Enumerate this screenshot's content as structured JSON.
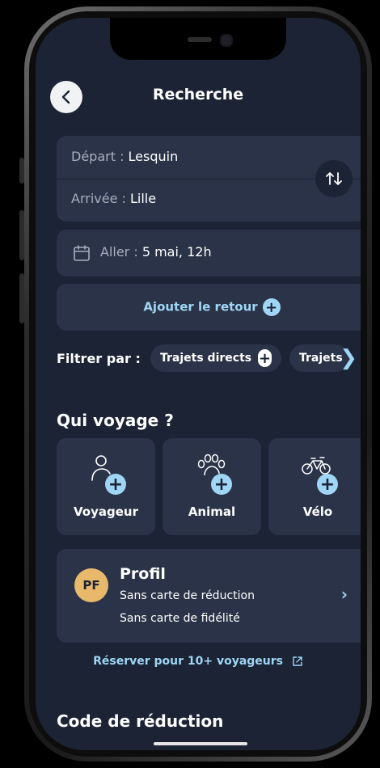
{
  "header": {
    "title": "Recherche"
  },
  "route": {
    "departure_label": "Départ : ",
    "departure_value": "Lesquin",
    "arrival_label": "Arrivée : ",
    "arrival_value": "Lille"
  },
  "outbound": {
    "label": "Aller : ",
    "value": "5 mai, 12h"
  },
  "return_button": {
    "label": "Ajouter le retour",
    "icon": "plus-icon"
  },
  "filters": {
    "label": "Filtrer par :",
    "chips": [
      "Trajets directs",
      "Trajets"
    ]
  },
  "travelers": {
    "title": "Qui voyage ?",
    "items": [
      {
        "label": "Voyageur",
        "icon": "person-icon"
      },
      {
        "label": "Animal",
        "icon": "paw-icon"
      },
      {
        "label": "Vélo",
        "icon": "bicycle-icon"
      }
    ]
  },
  "profile": {
    "initials": "PF",
    "title": "Profil",
    "line1": "Sans carte de réduction",
    "line2": "Sans carte de fidélité"
  },
  "group_link": {
    "label": "Réserver pour 10+ voyageurs"
  },
  "discount": {
    "title": "Code de réduction"
  },
  "colors": {
    "background": "#1b2334",
    "card": "#2a3347",
    "accent": "#9fd6f5",
    "avatar": "#e8b96b"
  }
}
